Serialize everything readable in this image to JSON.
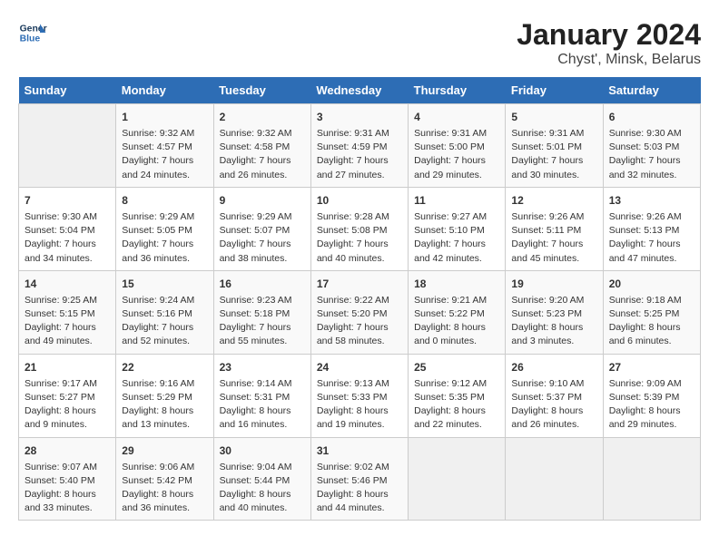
{
  "logo": {
    "line1": "General",
    "line2": "Blue"
  },
  "title": "January 2024",
  "subtitle": "Chyst', Minsk, Belarus",
  "weekdays": [
    "Sunday",
    "Monday",
    "Tuesday",
    "Wednesday",
    "Thursday",
    "Friday",
    "Saturday"
  ],
  "weeks": [
    [
      {
        "day": "",
        "info": ""
      },
      {
        "day": "1",
        "info": "Sunrise: 9:32 AM\nSunset: 4:57 PM\nDaylight: 7 hours\nand 24 minutes."
      },
      {
        "day": "2",
        "info": "Sunrise: 9:32 AM\nSunset: 4:58 PM\nDaylight: 7 hours\nand 26 minutes."
      },
      {
        "day": "3",
        "info": "Sunrise: 9:31 AM\nSunset: 4:59 PM\nDaylight: 7 hours\nand 27 minutes."
      },
      {
        "day": "4",
        "info": "Sunrise: 9:31 AM\nSunset: 5:00 PM\nDaylight: 7 hours\nand 29 minutes."
      },
      {
        "day": "5",
        "info": "Sunrise: 9:31 AM\nSunset: 5:01 PM\nDaylight: 7 hours\nand 30 minutes."
      },
      {
        "day": "6",
        "info": "Sunrise: 9:30 AM\nSunset: 5:03 PM\nDaylight: 7 hours\nand 32 minutes."
      }
    ],
    [
      {
        "day": "7",
        "info": "Sunrise: 9:30 AM\nSunset: 5:04 PM\nDaylight: 7 hours\nand 34 minutes."
      },
      {
        "day": "8",
        "info": "Sunrise: 9:29 AM\nSunset: 5:05 PM\nDaylight: 7 hours\nand 36 minutes."
      },
      {
        "day": "9",
        "info": "Sunrise: 9:29 AM\nSunset: 5:07 PM\nDaylight: 7 hours\nand 38 minutes."
      },
      {
        "day": "10",
        "info": "Sunrise: 9:28 AM\nSunset: 5:08 PM\nDaylight: 7 hours\nand 40 minutes."
      },
      {
        "day": "11",
        "info": "Sunrise: 9:27 AM\nSunset: 5:10 PM\nDaylight: 7 hours\nand 42 minutes."
      },
      {
        "day": "12",
        "info": "Sunrise: 9:26 AM\nSunset: 5:11 PM\nDaylight: 7 hours\nand 45 minutes."
      },
      {
        "day": "13",
        "info": "Sunrise: 9:26 AM\nSunset: 5:13 PM\nDaylight: 7 hours\nand 47 minutes."
      }
    ],
    [
      {
        "day": "14",
        "info": "Sunrise: 9:25 AM\nSunset: 5:15 PM\nDaylight: 7 hours\nand 49 minutes."
      },
      {
        "day": "15",
        "info": "Sunrise: 9:24 AM\nSunset: 5:16 PM\nDaylight: 7 hours\nand 52 minutes."
      },
      {
        "day": "16",
        "info": "Sunrise: 9:23 AM\nSunset: 5:18 PM\nDaylight: 7 hours\nand 55 minutes."
      },
      {
        "day": "17",
        "info": "Sunrise: 9:22 AM\nSunset: 5:20 PM\nDaylight: 7 hours\nand 58 minutes."
      },
      {
        "day": "18",
        "info": "Sunrise: 9:21 AM\nSunset: 5:22 PM\nDaylight: 8 hours\nand 0 minutes."
      },
      {
        "day": "19",
        "info": "Sunrise: 9:20 AM\nSunset: 5:23 PM\nDaylight: 8 hours\nand 3 minutes."
      },
      {
        "day": "20",
        "info": "Sunrise: 9:18 AM\nSunset: 5:25 PM\nDaylight: 8 hours\nand 6 minutes."
      }
    ],
    [
      {
        "day": "21",
        "info": "Sunrise: 9:17 AM\nSunset: 5:27 PM\nDaylight: 8 hours\nand 9 minutes."
      },
      {
        "day": "22",
        "info": "Sunrise: 9:16 AM\nSunset: 5:29 PM\nDaylight: 8 hours\nand 13 minutes."
      },
      {
        "day": "23",
        "info": "Sunrise: 9:14 AM\nSunset: 5:31 PM\nDaylight: 8 hours\nand 16 minutes."
      },
      {
        "day": "24",
        "info": "Sunrise: 9:13 AM\nSunset: 5:33 PM\nDaylight: 8 hours\nand 19 minutes."
      },
      {
        "day": "25",
        "info": "Sunrise: 9:12 AM\nSunset: 5:35 PM\nDaylight: 8 hours\nand 22 minutes."
      },
      {
        "day": "26",
        "info": "Sunrise: 9:10 AM\nSunset: 5:37 PM\nDaylight: 8 hours\nand 26 minutes."
      },
      {
        "day": "27",
        "info": "Sunrise: 9:09 AM\nSunset: 5:39 PM\nDaylight: 8 hours\nand 29 minutes."
      }
    ],
    [
      {
        "day": "28",
        "info": "Sunrise: 9:07 AM\nSunset: 5:40 PM\nDaylight: 8 hours\nand 33 minutes."
      },
      {
        "day": "29",
        "info": "Sunrise: 9:06 AM\nSunset: 5:42 PM\nDaylight: 8 hours\nand 36 minutes."
      },
      {
        "day": "30",
        "info": "Sunrise: 9:04 AM\nSunset: 5:44 PM\nDaylight: 8 hours\nand 40 minutes."
      },
      {
        "day": "31",
        "info": "Sunrise: 9:02 AM\nSunset: 5:46 PM\nDaylight: 8 hours\nand 44 minutes."
      },
      {
        "day": "",
        "info": ""
      },
      {
        "day": "",
        "info": ""
      },
      {
        "day": "",
        "info": ""
      }
    ]
  ]
}
